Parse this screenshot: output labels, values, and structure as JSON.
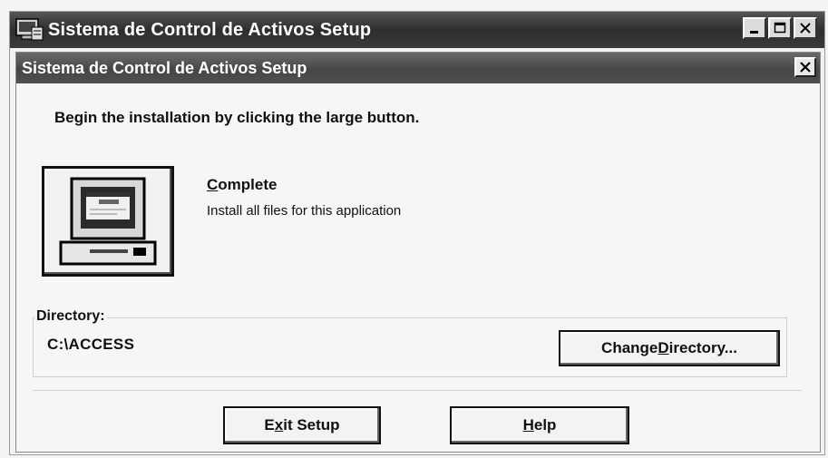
{
  "window": {
    "title": "Sistema de Control de Activos Setup",
    "buttons": [
      "minimize",
      "maximize",
      "close"
    ]
  },
  "dialog": {
    "title": "Sistema de Control de Activos Setup",
    "instruction": "Begin the installation by clicking the large button.",
    "option": {
      "icon": "computer-icon",
      "title_pre": "",
      "title_mnemonic": "C",
      "title_post": "omplete",
      "description": "Install all files for this application"
    },
    "directory": {
      "label": "Directory:",
      "value": "C:\\ACCESS",
      "change_pre": "Change ",
      "change_mnemonic": "D",
      "change_post": "irectory..."
    },
    "buttons": {
      "exit_pre": "E",
      "exit_mnemonic": "x",
      "exit_post": "it Setup",
      "help_pre": "",
      "help_mnemonic": "H",
      "help_post": "elp"
    }
  }
}
